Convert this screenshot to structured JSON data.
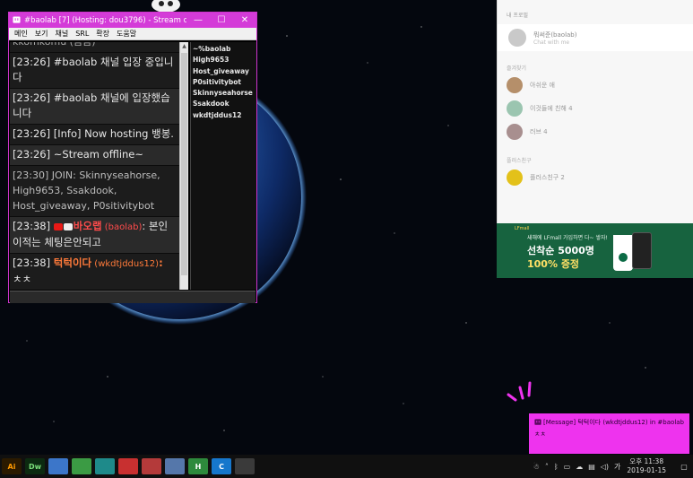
{
  "chat_window": {
    "title": "#baolab [7] (Hosting: dou3796) - Stream offline - ...",
    "controls": {
      "minimize": "—",
      "maximize": "☐",
      "close": "✕"
    },
    "menu": [
      "메인",
      "보기",
      "채널",
      "SRL",
      "확장",
      "도움말"
    ],
    "messages": [
      {
        "text": "kkomkomu (꼼꼼)"
      },
      {
        "text": "[23:26] #baolab 채널 입장 중입니다"
      },
      {
        "text": "[23:26] #baolab 채널에 입장했습니다"
      },
      {
        "text": "[23:26] [Info] Now hosting 뱅봉."
      },
      {
        "text": "[23:26] ~Stream offline~"
      },
      {
        "text": "[23:30] JOIN: Skinnyseahorse, High9653, Ssakdook, Host_giveaway, P0sitivitybot"
      },
      {
        "time": "[23:38] ",
        "nick": "바오랩",
        "login": " (baolab)",
        "text": ": 본인 이적는 체팅은안되고"
      },
      {
        "time": "[23:38] ",
        "nick": "턱턱이다",
        "login": " (wkdtjddus12)",
        "text": ":",
        "text2": "ㅊㅊ"
      }
    ],
    "users": [
      "~%baolab",
      "High9653",
      "Host_giveaway",
      "P0sitivitybot",
      "Skinnyseahorse",
      "Ssakdook",
      "wkdtjddus12"
    ]
  },
  "side_panel": {
    "header": "내 프로필",
    "me": {
      "name": "뭐써준(baolab)",
      "sub": "Chat with me"
    },
    "section_favorites": "즐겨찾기",
    "favorites": [
      "아쉬운 애",
      "이것들에 친해 4",
      "러브 4"
    ],
    "section_friends": "플러스친구",
    "friends": [
      "플러스친구 2"
    ]
  },
  "ad": {
    "brand": "LFmall",
    "line1": "새해에 LFmall 가입하면 다~ 쌓자!",
    "line2": "선착순 5000명",
    "line3": "100% 증정"
  },
  "toast": {
    "title": "[Message] 턱턱이다 (wkdtjddus12) in #baolab",
    "body": "ㅊㅊ"
  },
  "taskbar": {
    "apps": [
      {
        "name": "illustrator",
        "label": "Ai",
        "color": "#2b1a00",
        "fg": "#ff9a00"
      },
      {
        "name": "dreamweaver",
        "label": "Dw",
        "color": "#0c2a10",
        "fg": "#7be07b"
      },
      {
        "name": "app-blue",
        "label": "",
        "color": "#3c76c9",
        "fg": "#fff"
      },
      {
        "name": "app-green",
        "label": "",
        "color": "#3b9b44",
        "fg": "#fff"
      },
      {
        "name": "app-teal",
        "label": "",
        "color": "#1e8a8a",
        "fg": "#fff"
      },
      {
        "name": "app-red",
        "label": "",
        "color": "#c83030",
        "fg": "#fff"
      },
      {
        "name": "app-gem",
        "label": "",
        "color": "#b43a3a",
        "fg": "#fff"
      },
      {
        "name": "app-gear",
        "label": "",
        "color": "#5577aa",
        "fg": "#fff"
      },
      {
        "name": "app-h",
        "label": "H",
        "color": "#2d8a3c",
        "fg": "#fff"
      },
      {
        "name": "app-c",
        "label": "C",
        "color": "#1677cc",
        "fg": "#fff"
      },
      {
        "name": "app-x",
        "label": "",
        "color": "#3a3a3a",
        "fg": "#fff"
      }
    ],
    "ime": "가",
    "clock_time": "오후 11:38",
    "clock_date": "2019-01-15"
  },
  "colors": {
    "accent": "#d43bd8",
    "toast_bg": "#ee33ee",
    "ad_green": "#17633f"
  }
}
